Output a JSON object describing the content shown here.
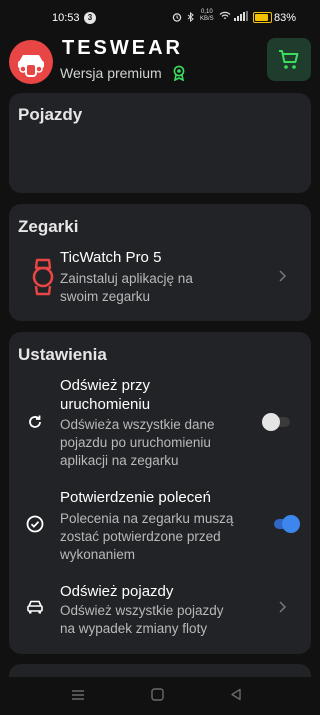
{
  "status_bar": {
    "time": "10:53",
    "notification_count": "3",
    "speed_value": "0,10",
    "speed_unit": "KB/S",
    "battery": "83%"
  },
  "header": {
    "brand": "TESWEAR",
    "subtitle": "Wersja premium",
    "accent_color": "#3ddc5f",
    "logo_color": "#e84545"
  },
  "vehicles": {
    "title": "Pojazdy"
  },
  "watches": {
    "title": "Zegarki",
    "item_title": "TicWatch Pro 5",
    "item_subtitle_line1": "Zainstaluj aplikację na",
    "item_subtitle_line2": "swoim zegarku"
  },
  "settings": {
    "title": "Ustawienia",
    "refresh_on_launch": {
      "title_line1": "Odśwież przy",
      "title_line2": "uruchomieniu",
      "sub_line1": "Odświeża wszystkie dane",
      "sub_line2": "pojazdu po uruchomieniu",
      "sub_line3": "aplikacji na zegarku",
      "enabled": false
    },
    "command_confirmation": {
      "title": "Potwierdzenie poleceń",
      "sub_line1": "Polecenia na zegarku muszą",
      "sub_line2": "zostać potwierdzone przed",
      "sub_line3": "wykonaniem",
      "enabled": true
    },
    "refresh_vehicles": {
      "title": "Odśwież pojazdy",
      "sub_line1": "Odśwież wszystkie pojazdy",
      "sub_line2": "na wypadek zmiany floty"
    }
  },
  "colors": {
    "background": "#111111",
    "card": "#222326",
    "toggle_on": "#3d86ee",
    "watch_icon": "#e84545"
  }
}
